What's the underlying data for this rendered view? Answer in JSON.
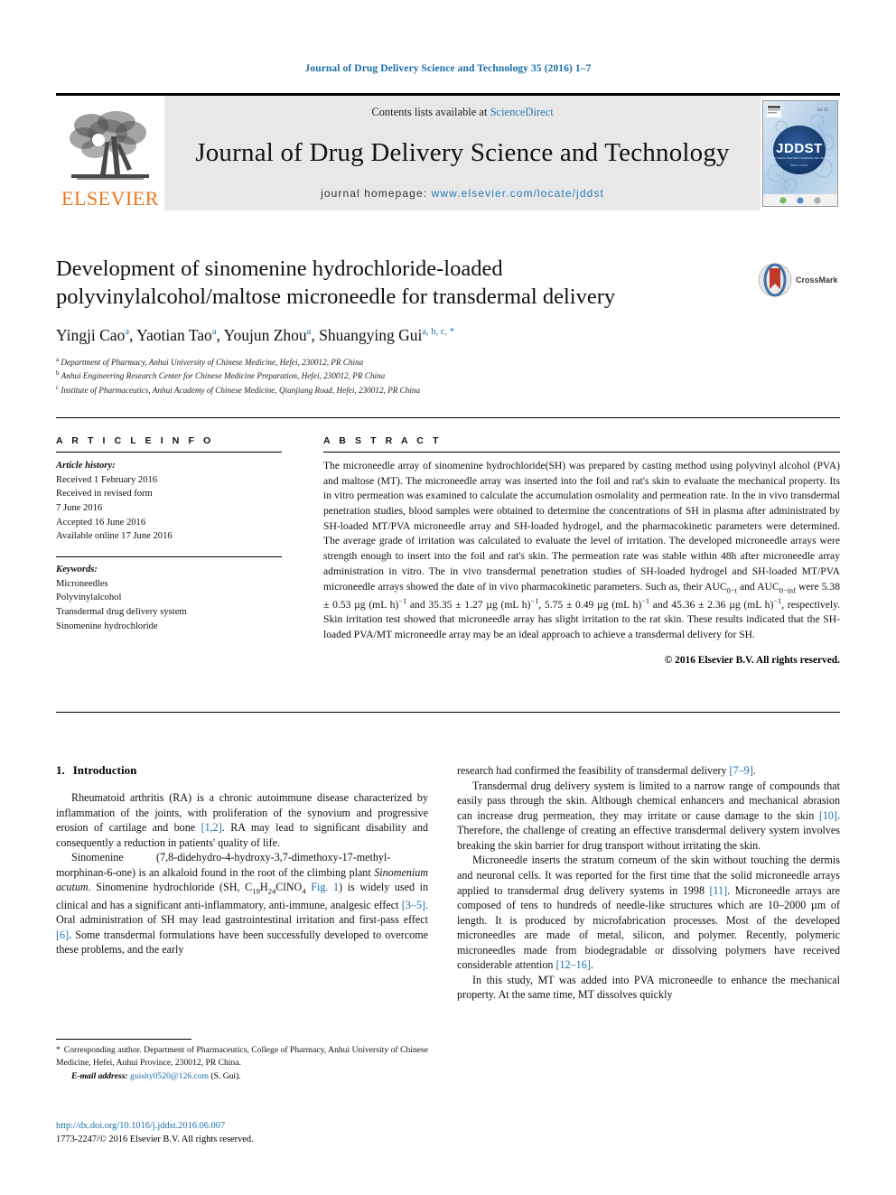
{
  "running_head": "Journal of Drug Delivery Science and Technology 35 (2016) 1–7",
  "masthead": {
    "publisher_name": "ELSEVIER",
    "contents_prefix": "Contents lists available at ",
    "contents_link": "ScienceDirect",
    "journal_title": "Journal of Drug Delivery Science and Technology",
    "homepage_prefix": "journal homepage: ",
    "homepage_url": "www.elsevier.com/locate/jddst",
    "cover_label": "JDDST"
  },
  "crossmark": {
    "label": "CrossMark"
  },
  "article": {
    "title_line1": "Development of sinomenine hydrochloride-loaded",
    "title_line2": "polyvinylalcohol/maltose microneedle for transdermal delivery",
    "authors": [
      {
        "name": "Yingji Cao",
        "marks": "a",
        "sep": ", "
      },
      {
        "name": "Yaotian Tao",
        "marks": "a",
        "sep": ", "
      },
      {
        "name": "Youjun Zhou",
        "marks": "a",
        "sep": ", "
      },
      {
        "name": "Shuangying Gui",
        "marks": "a, b, c, *",
        "sep": ""
      }
    ],
    "affiliations": [
      {
        "mark": "a",
        "text": "Department of Pharmacy, Anhui University of Chinese Medicine, Hefei, 230012, PR China"
      },
      {
        "mark": "b",
        "text": "Anhui Engineering Research Center for Chinese Medicine Preparation, Hefei, 230012, PR China"
      },
      {
        "mark": "c",
        "text": "Institute of Pharmaceutics, Anhui Academy of Chinese Medicine, Qianjiang Road, Hefei, 230012, PR China"
      }
    ]
  },
  "article_info": {
    "heading": "A R T I C L E   I N F O",
    "history_label": "Article history:",
    "history": [
      "Received 1 February 2016",
      "Received in revised form",
      "7 June 2016",
      "Accepted 16 June 2016",
      "Available online 17 June 2016"
    ],
    "keywords_label": "Keywords:",
    "keywords": [
      "Microneedles",
      "Polyvinylalcohol",
      "Transdermal drug delivery system",
      "Sinomenine hydrochloride"
    ]
  },
  "abstract": {
    "heading": "A B S T R A C T",
    "part1": "The microneedle array of sinomenine hydrochloride(SH) was prepared by casting method using polyvinyl alcohol (PVA) and maltose (MT). The microneedle array was inserted into the foil and rat's skin to evaluate the mechanical property. Its in vitro permeation was examined to calculate the accumulation osmolality and permeation rate. In the in vivo transdermal penetration studies, blood samples were obtained to determine the concentrations of SH in plasma after administrated by SH-loaded MT/PVA microneedle array and SH-loaded hydrogel, and the pharmacokinetic parameters were determined. The average grade of irritation was calculated to evaluate the level of irritation. The developed microneedle arrays were strength enough to insert into the foil and rat's skin. The permeation rate was stable within 48h after microneedle array administration in vitro. The in vivo transdermal penetration studies of SH-loaded hydrogel and SH-loaded MT/PVA microneedle arrays showed the date of in vivo pharmacokinetic parameters. Such as, their AUC",
    "sub1": "0−t",
    "mid1": " and AUC",
    "sub2": "0−inf",
    "mid2": " were 5.38 ± 0.53 µg (mL h)",
    "sup1": "−1",
    "mid3": " and 35.35 ± 1.27 µg (mL h)",
    "sup2": "−1",
    "mid4": ", 5.75 ± 0.49 µg (mL h)",
    "sup3": "−1",
    "mid5": " and 45.36 ± 2.36 µg (mL h)",
    "sup4": "−1",
    "part2": ", respectively. Skin irritation test showed that microneedle array has slight irritation to the rat skin. These results indicated that the SH-loaded PVA/MT microneedle array may be an ideal approach to achieve a transdermal delivery for SH.",
    "copyright": "© 2016 Elsevier B.V. All rights reserved."
  },
  "body": {
    "section_number": "1.",
    "section_title": "Introduction",
    "left_paragraphs": [
      {
        "pre": "Rheumatoid arthritis (RA) is a chronic autoimmune disease characterized by inflammation of the joints, with proliferation of the synovium and progressive erosion of cartilage and bone ",
        "ref": "[1,2]",
        "post": ". RA may lead to significant disability and consequently a reduction in patients' quality of life."
      }
    ],
    "para_sinomenine": {
      "s1": "Sinomenine   (7,8-didehydro-4-hydroxy-3,7-dimethoxy-17-methyl-morphinan-6-one) is an alkaloid found in the root of the climbing plant ",
      "italic1": "Sinomenium acutum",
      "s2": ". Sinomenine hydrochloride (SH, C",
      "sub_19": "19",
      "s3": "H",
      "sub_24": "24",
      "s4": "ClNO",
      "sub_4": "4",
      "s5": " ",
      "fig_link": "Fig. 1",
      "s6": ") is widely used in clinical and has a significant anti-inflammatory, anti-immune, analgesic effect ",
      "ref1": "[3–5]",
      "s7": ". Oral administration of SH may lead gastrointestinal irritation and first-pass effect ",
      "ref2": "[6]",
      "s8": ". Some transdermal formulations have been successfully developed to overcome these problems, and the early"
    },
    "right_paragraphs": [
      {
        "pre": "research had confirmed the feasibility of transdermal delivery ",
        "ref": "[7–9]",
        "post": ".",
        "indent": false
      },
      {
        "pre": "Transdermal drug delivery system is limited to a narrow range of compounds that easily pass through the skin. Although chemical enhancers and mechanical abrasion can increase drug permeation, they may irritate or cause damage to the skin ",
        "ref": "[10]",
        "post": ". Therefore, the challenge of creating an effective transdermal delivery system involves breaking the skin barrier for drug transport without irritating the skin.",
        "indent": true
      }
    ],
    "para_microneedle": {
      "s1": "Microneedle inserts the stratum corneum of the skin without touching the dermis and neuronal cells. It was reported for the first time that the solid microneedle arrays applied to transdermal drug delivery systems in 1998 ",
      "ref1": "[11]",
      "s2": ". Microneedle arrays are composed of tens to hundreds of needle-like structures which are 10–2000 µm of length. It is produced by microfabrication processes. Most of the developed microneedles are made of metal, silicon, and polymer. Recently, polymeric microneedles made from biodegradable or dissolving polymers have received considerable attention ",
      "ref2": "[12–16]",
      "s3": "."
    },
    "para_study": "In this study, MT was added into PVA microneedle to enhance the mechanical property. At the same time, MT dissolves quickly"
  },
  "footnote": {
    "star": "*",
    "text": "Corresponding author. Department of Pharmaceutics, College of Pharmacy, Anhui University of Chinese Medicine, Hefei, Anhui Province, 230012, PR China.",
    "email_label": "E-mail address:",
    "email": "guishy0520@126.com",
    "email_owner": "(S. Gui)."
  },
  "footer": {
    "doi": "http://dx.doi.org/10.1016/j.jddst.2016.06.007",
    "issn_line": "1773-2247/© 2016 Elsevier B.V. All rights reserved."
  },
  "colors": {
    "link": "#1a6ea8",
    "elsevier_orange": "#E87722",
    "masthead_gray": "#e8e8e8"
  }
}
